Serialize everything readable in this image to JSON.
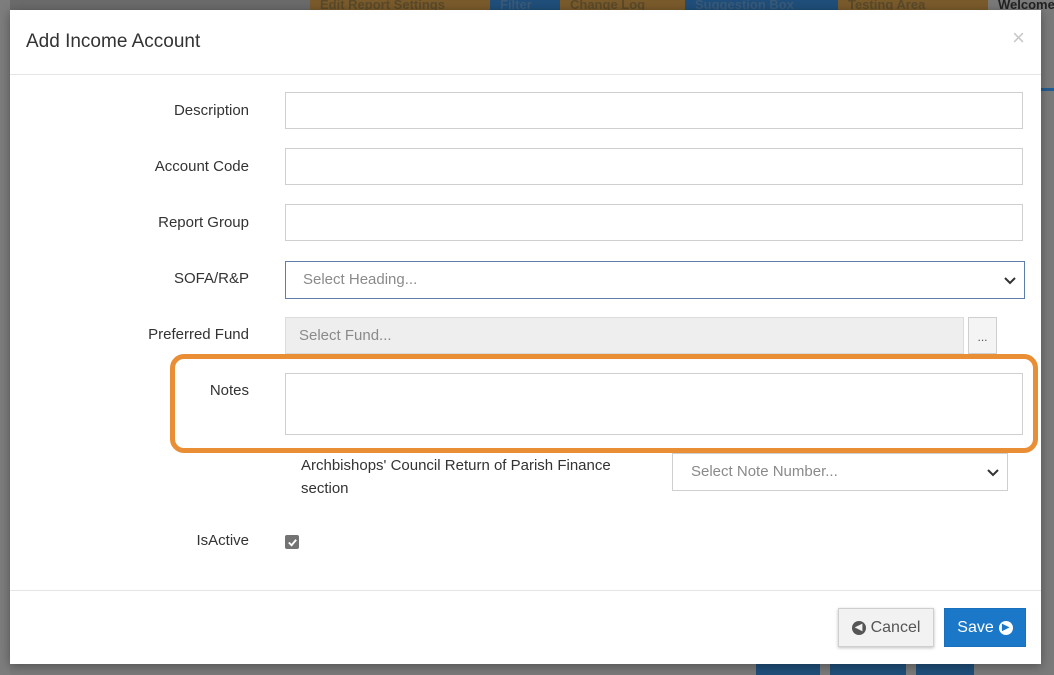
{
  "background": {
    "topbar_buttons": [
      "Edit Report Settings",
      "Filter",
      "Change Log",
      "Suggestion Box",
      "Testing Area",
      "Welcome"
    ]
  },
  "modal": {
    "title": "Add Income Account",
    "close_icon": "close-icon"
  },
  "form": {
    "description": {
      "label": "Description",
      "value": ""
    },
    "account_code": {
      "label": "Account Code",
      "value": ""
    },
    "report_group": {
      "label": "Report Group",
      "value": ""
    },
    "sofa": {
      "label": "SOFA/R&P",
      "selected": "Select Heading..."
    },
    "preferred_fund": {
      "label": "Preferred Fund",
      "placeholder": "Select Fund...",
      "picker_label": "..."
    },
    "notes": {
      "label": "Notes",
      "value": ""
    },
    "archbishops": {
      "label": "Archbishops' Council Return of Parish Finance section",
      "selected": "Select Note Number..."
    },
    "is_active": {
      "label": "IsActive",
      "checked": true
    }
  },
  "footer": {
    "cancel_label": "Cancel",
    "save_label": "Save"
  },
  "colors": {
    "highlight": "#e98e34",
    "primary": "#1b78c8"
  }
}
